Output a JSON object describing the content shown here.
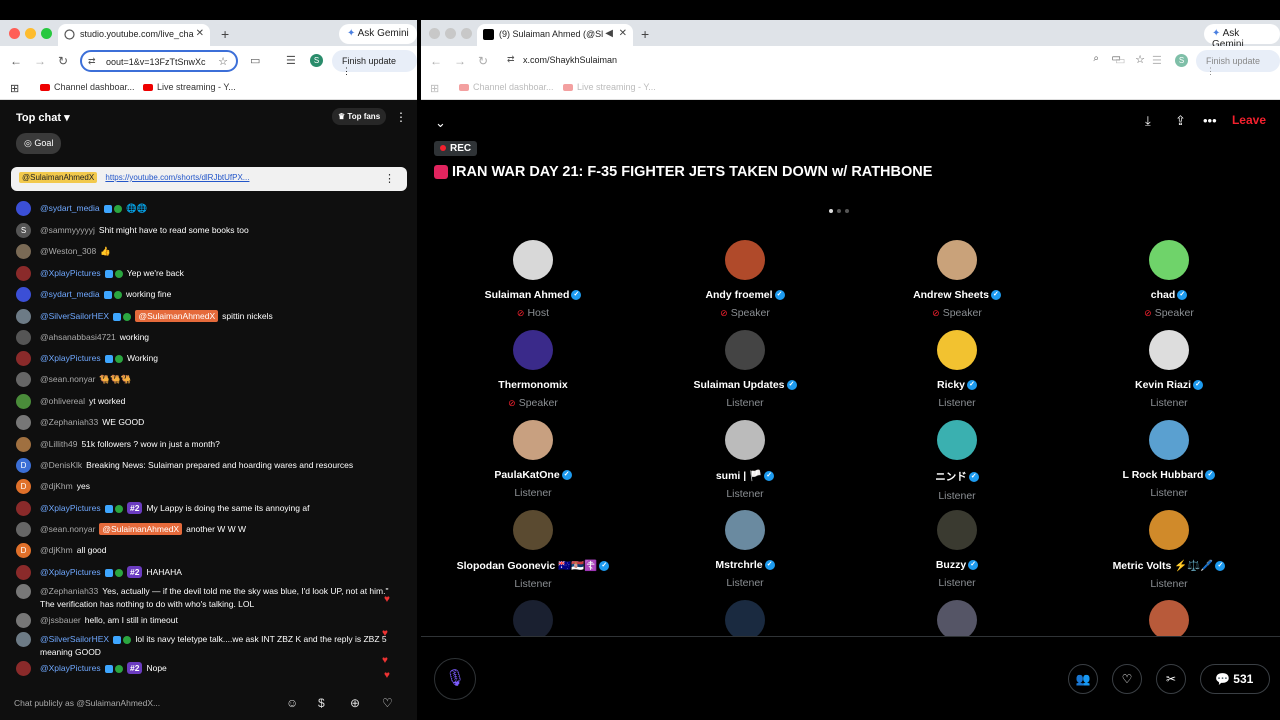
{
  "left_browser": {
    "tab_title": "studio.youtube.com/live_cha",
    "gemini": "Ask Gemini",
    "url": "oout=1&v=13FzTtSnwXc",
    "finish_update": "Finish update",
    "profile_letter": "S",
    "bookmarks": [
      "Channel dashboar...",
      "Live streaming - Y..."
    ]
  },
  "chat": {
    "title": "Top chat",
    "top_fans": "Top fans",
    "goal": "Goal",
    "pinned_user": "@SulaimanAhmedX",
    "pinned_link": "https://youtube.com/shorts/dlRJbtUfPX...",
    "messages": [
      {
        "user": "@sydart_media",
        "text": "🌐🌐",
        "color": "#3b4fd6",
        "letter": "",
        "member": true,
        "mod": true,
        "rank": "",
        "mention": ""
      },
      {
        "user": "@sammyyyyyj",
        "text": "Shit might have to read some books too",
        "color": "#555",
        "letter": "S",
        "member": false,
        "mod": false,
        "rank": "",
        "mention": ""
      },
      {
        "user": "@Weston_308",
        "text": "👍",
        "color": "#7a6a55",
        "letter": "",
        "member": false,
        "mod": false,
        "rank": "",
        "mention": ""
      },
      {
        "user": "@XplayPictures",
        "text": "Yep we're back",
        "color": "#8a2a2a",
        "letter": "",
        "member": true,
        "mod": true,
        "rank": "",
        "mention": ""
      },
      {
        "user": "@sydart_media",
        "text": "working fine",
        "color": "#3b4fd6",
        "letter": "",
        "member": true,
        "mod": true,
        "rank": "",
        "mention": ""
      },
      {
        "user": "@SilverSailorHEX",
        "text": "spittin nickels",
        "color": "#6d7b86",
        "letter": "",
        "member": true,
        "mod": true,
        "rank": "",
        "mention": "@SulaimanAhmedX"
      },
      {
        "user": "@ahsanabbasi4721",
        "text": "working",
        "color": "#555",
        "letter": "",
        "member": false,
        "mod": false,
        "rank": "",
        "mention": ""
      },
      {
        "user": "@XplayPictures",
        "text": "Working",
        "color": "#8a2a2a",
        "letter": "",
        "member": true,
        "mod": true,
        "rank": "",
        "mention": ""
      },
      {
        "user": "@sean.nonyar",
        "text": "🐫🐫🐫",
        "color": "#666",
        "letter": "",
        "member": false,
        "mod": false,
        "rank": "",
        "mention": ""
      },
      {
        "user": "@ohlivereal",
        "text": "yt worked",
        "color": "#4a8c3a",
        "letter": "",
        "member": false,
        "mod": false,
        "rank": "",
        "mention": ""
      },
      {
        "user": "@Zephaniah33",
        "text": "WE GOOD",
        "color": "#777",
        "letter": "",
        "member": false,
        "mod": false,
        "rank": "",
        "mention": ""
      },
      {
        "user": "@Lillith49",
        "text": "51k followers ? wow in just a month?",
        "color": "#a07040",
        "letter": "",
        "member": false,
        "mod": false,
        "rank": "",
        "mention": ""
      },
      {
        "user": "@DenisKlk",
        "text": "Breaking News: Sulaiman prepared and hoarding wares and resources",
        "color": "#3b6fd6",
        "letter": "D",
        "member": false,
        "mod": false,
        "rank": "",
        "mention": ""
      },
      {
        "user": "@djKhm",
        "text": "yes",
        "color": "#e0702a",
        "letter": "D",
        "member": false,
        "mod": false,
        "rank": "",
        "mention": ""
      },
      {
        "user": "@XplayPictures",
        "text": "My Lappy is doing the same its annoying af",
        "color": "#8a2a2a",
        "letter": "",
        "member": true,
        "mod": true,
        "rank": "#2",
        "mention": ""
      },
      {
        "user": "@sean.nonyar",
        "text": "another W W W",
        "color": "#666",
        "letter": "",
        "member": false,
        "mod": false,
        "rank": "",
        "mention": "@SulaimanAhmedX"
      },
      {
        "user": "@djKhm",
        "text": "all good",
        "color": "#e0702a",
        "letter": "D",
        "member": false,
        "mod": false,
        "rank": "",
        "mention": ""
      },
      {
        "user": "@XplayPictures",
        "text": "HAHAHA",
        "color": "#8a2a2a",
        "letter": "",
        "member": true,
        "mod": true,
        "rank": "#2",
        "mention": ""
      },
      {
        "user": "@Zephaniah33",
        "text": "Yes, actually — if the devil told me the sky was blue, I'd look UP, not at him.\"",
        "text2": "The verification has nothing to do with who's talking. LOL",
        "color": "#777",
        "letter": "",
        "member": false,
        "mod": false,
        "rank": "",
        "mention": ""
      },
      {
        "user": "@jssbauer",
        "text": "hello, am I still in timeout",
        "color": "#777",
        "letter": "",
        "member": false,
        "mod": false,
        "rank": "",
        "mention": ""
      },
      {
        "user": "@SilverSailorHEX",
        "text": "lol its navy teletype talk....we ask INT ZBZ K and the reply is ZBZ 5",
        "text2": "meaning GOOD",
        "color": "#6d7b86",
        "letter": "",
        "member": true,
        "mod": true,
        "rank": "",
        "mention": ""
      },
      {
        "user": "@XplayPictures",
        "text": "Nope",
        "color": "#8a2a2a",
        "letter": "",
        "member": true,
        "mod": true,
        "rank": "#2",
        "mention": ""
      }
    ],
    "input_placeholder": "Chat publicly as @SulaimanAhmedX..."
  },
  "right_browser": {
    "tab_title": "(9) Sulaiman Ahmed (@Sl",
    "gemini": "Ask Gemini",
    "url": "x.com/ShaykhSulaiman",
    "finish_update": "Finish update",
    "profile_letter": "S",
    "bookmarks": [
      "Channel dashboar...",
      "Live streaming - Y..."
    ]
  },
  "space": {
    "leave": "Leave",
    "rec": "REC",
    "title": "IRAN WAR DAY 21: F-35 FIGHTER JETS TAKEN DOWN w/ RATHBONE",
    "participants": [
      {
        "name": "Sulaiman Ahmed",
        "role": "Host",
        "verified": true,
        "mic": true,
        "color": "#d8d8d8"
      },
      {
        "name": "Andy froemel",
        "role": "Speaker",
        "verified": true,
        "mic": true,
        "color": "#b04a2a"
      },
      {
        "name": "Andrew Sheets",
        "role": "Speaker",
        "verified": true,
        "mic": true,
        "color": "#c9a27a"
      },
      {
        "name": "chad",
        "role": "Speaker",
        "verified": true,
        "mic": true,
        "color": "#6fd36a"
      },
      {
        "name": "Thermonomix",
        "role": "Speaker",
        "verified": false,
        "mic": true,
        "color": "#3a2a8a"
      },
      {
        "name": "Sulaiman Updates",
        "role": "Listener",
        "verified": true,
        "mic": false,
        "color": "#444"
      },
      {
        "name": "Ricky",
        "role": "Listener",
        "verified": true,
        "mic": false,
        "color": "#f2c230"
      },
      {
        "name": "Kevin Riazi",
        "role": "Listener",
        "verified": true,
        "mic": false,
        "color": "#ddd"
      },
      {
        "name": "PaulaKatOne",
        "role": "Listener",
        "verified": true,
        "mic": false,
        "color": "#c8a080"
      },
      {
        "name": "sumi | 🏳️",
        "role": "Listener",
        "verified": true,
        "mic": false,
        "color": "#bbb"
      },
      {
        "name": "ニンド",
        "role": "Listener",
        "verified": true,
        "mic": false,
        "color": "#3ab0b0"
      },
      {
        "name": "L Rock Hubbard",
        "role": "Listener",
        "verified": true,
        "mic": false,
        "color": "#5aa0d0"
      },
      {
        "name": "Slopodan Goonevic 🇦🇺🇷🇸☦️",
        "role": "Listener",
        "verified": true,
        "mic": false,
        "color": "#5a4a30"
      },
      {
        "name": "Mstrchrle",
        "role": "Listener",
        "verified": true,
        "mic": false,
        "color": "#6a8aa0"
      },
      {
        "name": "Buzzy",
        "role": "Listener",
        "verified": true,
        "mic": false,
        "color": "#3a3a30"
      },
      {
        "name": "Metric Volts ⚡⚖️🖊️",
        "role": "Listener",
        "verified": true,
        "mic": false,
        "color": "#d08a2a"
      }
    ],
    "partial_row_colors": [
      "#1a2030",
      "#1a2a40",
      "#556",
      "#b85a3a"
    ],
    "reply_count": "531"
  }
}
